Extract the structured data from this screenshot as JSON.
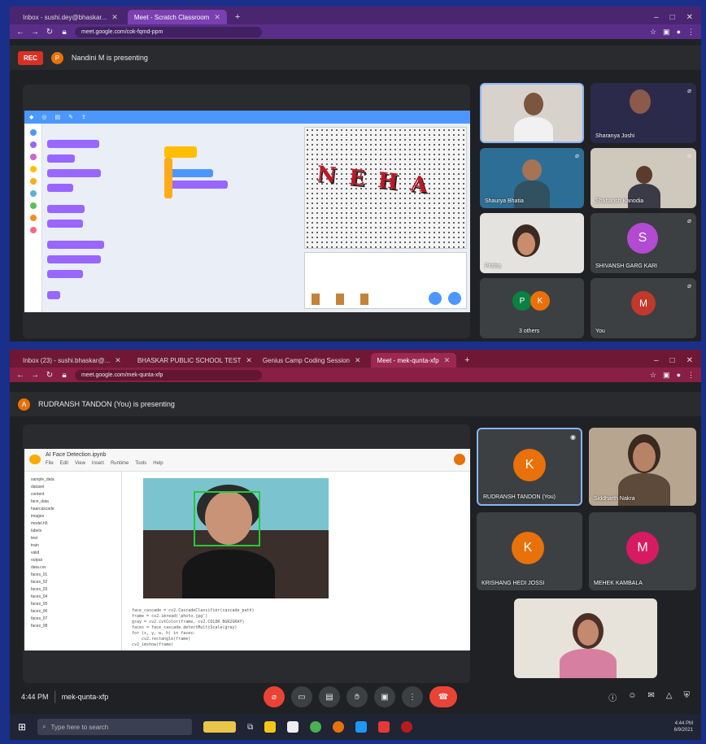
{
  "top": {
    "tabs": [
      {
        "label": "Inbox - sushi.dey@bhaskar..."
      },
      {
        "label": "Meet - Scratch Classroom"
      }
    ],
    "url": "meet.google.com/cok-fqmd-ppm",
    "recording_label": "REC",
    "presenter_initial": "P",
    "presenting_text": "Nandini M is presenting",
    "scratch_word": "NEHA",
    "tiles": [
      {
        "name": "",
        "kind": "video"
      },
      {
        "name": "Sharanya Joshi",
        "kind": "video"
      },
      {
        "name": "Shaurya Bhatia",
        "kind": "video"
      },
      {
        "name": "Shahansh Kanodia",
        "kind": "video"
      },
      {
        "name": "Prisha",
        "kind": "video"
      },
      {
        "name": "SHIVANSH GARG KARI",
        "kind": "avatar",
        "initial": "S",
        "color": "#b24bd1"
      },
      {
        "name": "3 others",
        "kind": "group",
        "initials": [
          "P",
          "K"
        ]
      },
      {
        "name": "You",
        "kind": "self",
        "initial": "M"
      }
    ]
  },
  "bottom": {
    "tabs": [
      {
        "label": "Inbox (23) - sushi.bhaskar@..."
      },
      {
        "label": "BHASKAR PUBLIC SCHOOL TEST"
      },
      {
        "label": "Genius Camp Coding Session"
      },
      {
        "label": "Meet - mek-qunta-xfp"
      }
    ],
    "url": "meet.google.com/mek-qunta-xfp",
    "presenter_initial": "A",
    "presenting_text": "RUDRANSH TANDON (You) is presenting",
    "colab_title": "AI Face Detection.ipynb",
    "colab_menu": [
      "File",
      "Edit",
      "View",
      "Insert",
      "Runtime",
      "Tools",
      "Help"
    ],
    "files": [
      "sample_data",
      "dataset",
      "content",
      "face_data",
      "haarcascade",
      "images",
      "model.h5",
      "labels",
      "test",
      "train",
      "valid",
      "output",
      "data.csv",
      "faces_01",
      "faces_02",
      "faces_03",
      "faces_04",
      "faces_05",
      "faces_06",
      "faces_07",
      "faces_08"
    ],
    "code_lines": [
      "face_cascade = cv2.CascadeClassifier(cascade_path)",
      "frame = cv2.imread('photo.jpg')",
      "gray = cv2.cvtColor(frame, cv2.COLOR_BGR2GRAY)",
      "faces = face_cascade.detectMultiScale(gray)",
      "for (x, y, w, h) in faces:",
      "    cv2.rectangle(frame)",
      "cv2_imshow(frame)"
    ],
    "tiles": [
      {
        "name": "RUDRANSH TANDON (You)",
        "kind": "avatar",
        "initial": "K",
        "color": "#e8710a"
      },
      {
        "name": "Siddharth Nakra",
        "kind": "video"
      },
      {
        "name": "KRISHANG HEDI JOSSI",
        "kind": "avatar",
        "initial": "K",
        "color": "#e8710a"
      },
      {
        "name": "MEHEK KAMBALA",
        "kind": "avatar",
        "initial": "M",
        "color": "#d81b60"
      },
      {
        "name": "",
        "kind": "video"
      }
    ],
    "time": "4:44 PM",
    "meeting_code": "mek-qunta-xfp",
    "taskbar_search": "Type here to search",
    "taskbar_time": "4:44 PM",
    "taskbar_date": "6/9/2021"
  }
}
